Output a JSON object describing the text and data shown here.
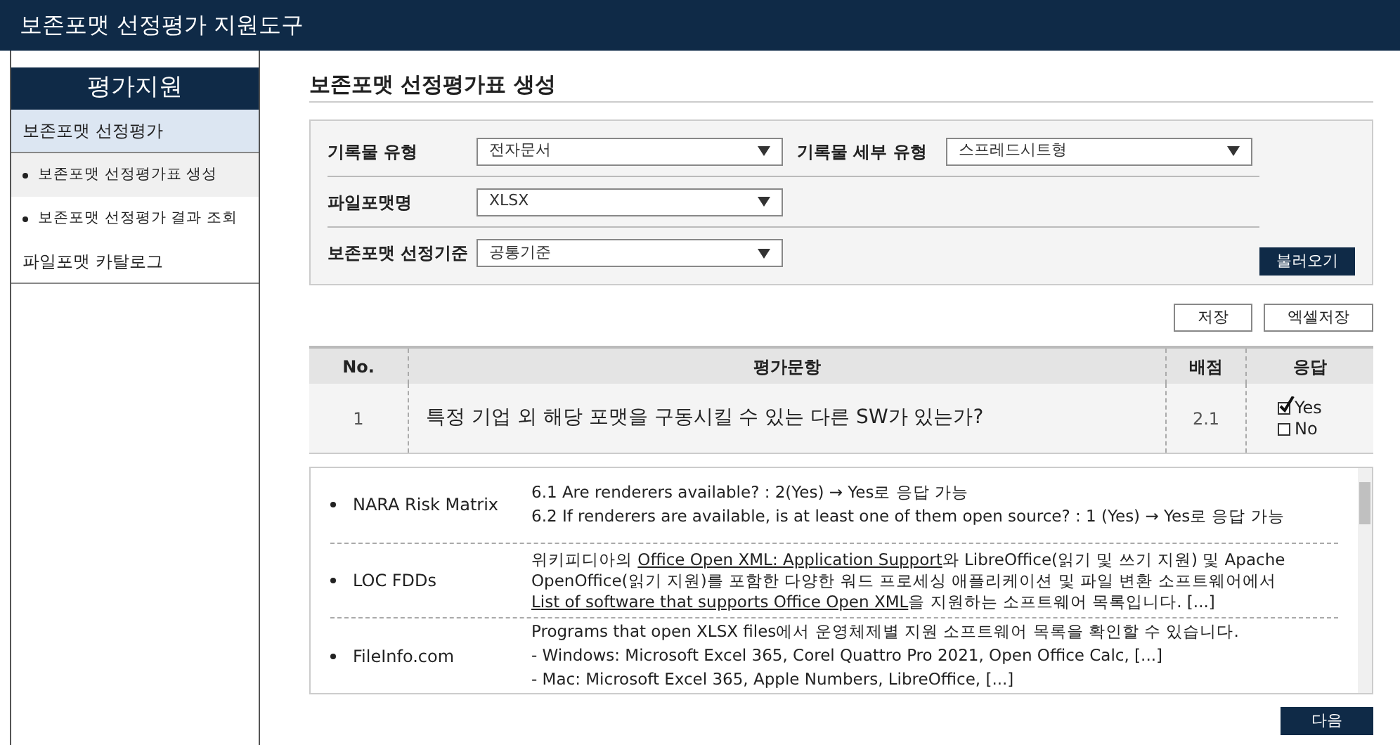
{
  "app_title": "보존포맷 선정평가 지원도구",
  "sidebar": {
    "title": "평가지원",
    "items": [
      {
        "label": "보존포맷 선정평가",
        "kind": "section",
        "selected": true
      },
      {
        "label": "보존포맷 선정평가표 생성",
        "kind": "sub",
        "selected": true
      },
      {
        "label": "보존포맷 선정평가 결과 조회",
        "kind": "sub",
        "selected": false
      },
      {
        "label": "파일포맷 카탈로그",
        "kind": "section",
        "selected": false
      }
    ]
  },
  "page_title": "보존포맷 선정평가표 생성",
  "form": {
    "rows": [
      {
        "fields": [
          {
            "label": "기록물 유형",
            "value": "전자문서"
          },
          {
            "label": "기록물 세부 유형",
            "value": "스프레드시트형"
          }
        ]
      },
      {
        "fields": [
          {
            "label": "파일포맷명",
            "value": "XLSX"
          }
        ]
      },
      {
        "fields": [
          {
            "label": "보존포맷 선정기준",
            "value": "공통기준"
          }
        ]
      }
    ],
    "load_button": "불러오기"
  },
  "actions": [
    "저장",
    "엑셀저장"
  ],
  "table": {
    "columns": [
      "No.",
      "평가문항",
      "배점",
      "응답"
    ],
    "rows": [
      {
        "no": "1",
        "question": "특정 기업 외 해당 포맷을 구동시킬 수 있는 다른 SW가 있는가?",
        "score": "2.1",
        "options": [
          {
            "label": "Yes",
            "checked": true
          },
          {
            "label": "No",
            "checked": false
          }
        ]
      }
    ]
  },
  "references": [
    {
      "source": "NARA Risk Matrix",
      "paragraphs": [
        [
          {
            "text": "6.1  Are renderers available? : 2(Yes)  →  Yes로 응답 가능",
            "link": false
          }
        ],
        [
          {
            "text": "6.2  If renderers are available, is at least one of them open source? : 1 (Yes) → Yes로 응답 가능",
            "link": false
          }
        ]
      ]
    },
    {
      "source": "LOC FDDs",
      "paragraphs": [
        [
          {
            "text": "위키피디아의 ",
            "link": false
          },
          {
            "text": "Office Open XML: Application Support",
            "link": true
          },
          {
            "text": "와 LibreOffice(읽기 및 쓰기 지원) 및 Apache OpenOffice(읽기 지원)를 포함한 다양한 워드 프로세싱 애플리케이션 및 파일 변환 소프트웨어에서 ",
            "link": false
          },
          {
            "text": "List of software that supports Office Open XML",
            "link": true
          },
          {
            "text": "을 지원하는 소프트웨어 목록입니다. [...]",
            "link": false
          }
        ]
      ]
    },
    {
      "source": "FileInfo.com",
      "paragraphs": [
        [
          {
            "text": "Programs that open XLSX files에서 운영체제별 지원 소프트웨어 목록을 확인할 수 있습니다.",
            "link": false
          }
        ],
        [
          {
            "text": "- Windows: Microsoft Excel 365, Corel Quattro Pro 2021, Open Office Calc, [...]",
            "link": false
          }
        ],
        [
          {
            "text": "- Mac: Microsoft Excel 365, Apple Numbers, LibreOffice, [...]",
            "link": false
          }
        ]
      ]
    }
  ],
  "next_button": "다음"
}
